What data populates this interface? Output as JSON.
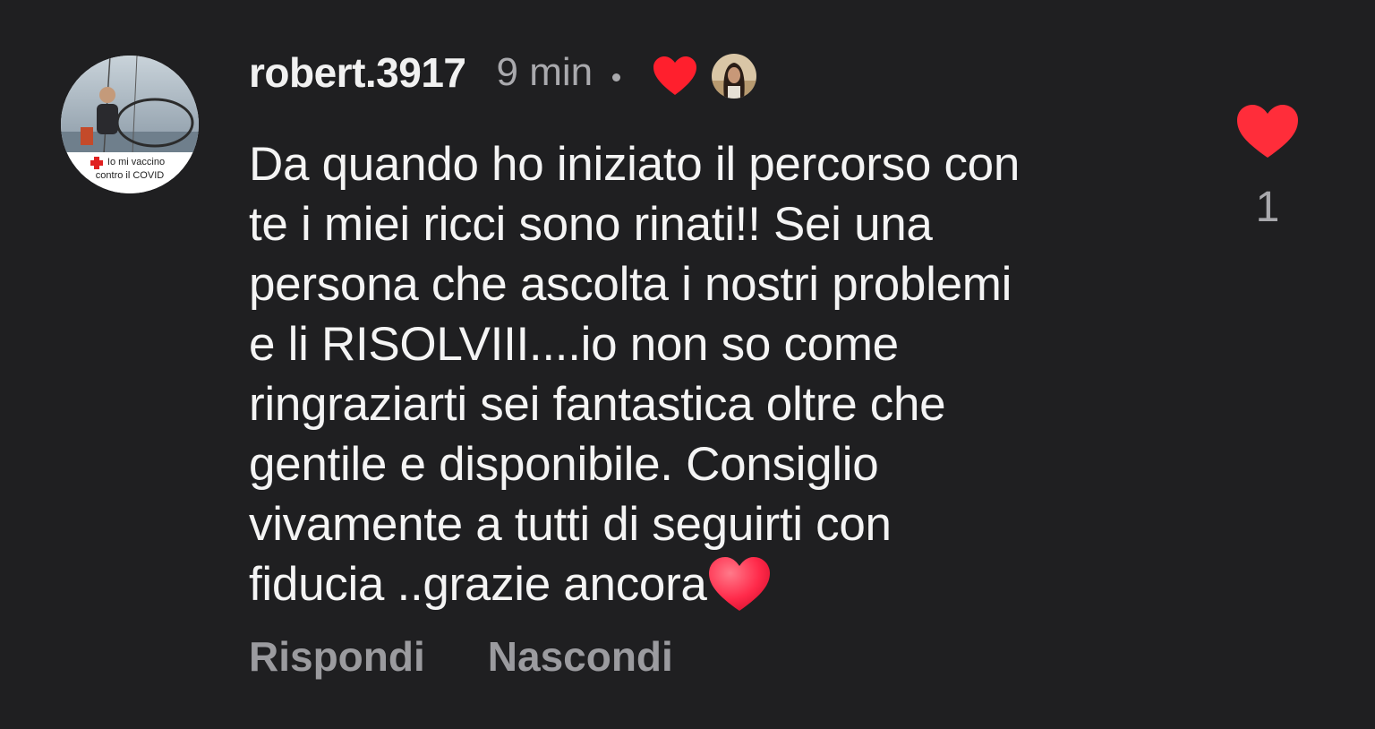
{
  "comment": {
    "username": "robert.3917",
    "time": "9 min",
    "avatar": {
      "frame_line1": "Io mi vaccino",
      "frame_line2": "contro il COVID"
    },
    "creator_liked_icon": "heart-filled-icon",
    "text": "Da quando ho iniziato il percorso con\nte i miei ricci sono rinati!! Sei una\npersona che ascolta i nostri problemi\ne li RISOLVIII....io non so come\nringraziarti sei fantastica oltre che\ngentile e disponibile.  Consiglio\nvivamente a tutti di seguirti con\nfiducia ..grazie ancora",
    "trailing_emoji": "heart-emoji",
    "reply_label": "Rispondi",
    "hide_label": "Nascondi",
    "like_count": "1"
  },
  "colors": {
    "background": "#1f1f21",
    "heart_red": "#ff2d3a",
    "secondary_text": "#9b9b9f"
  }
}
